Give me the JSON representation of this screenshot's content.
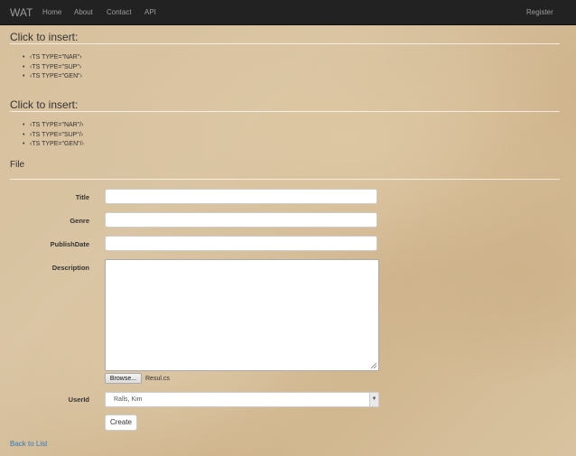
{
  "navbar": {
    "brand": "WAT",
    "links": [
      "Home",
      "About",
      "Contact",
      "API"
    ],
    "register": "Register"
  },
  "insert_sections": [
    {
      "heading": "Click to insert:",
      "items": [
        "‹TS TYPE=\"NAR\"›",
        "‹TS TYPE=\"SUP\"›",
        "‹TS TYPE=\"GEN\"›"
      ]
    },
    {
      "heading": "Click to insert:",
      "items": [
        "‹TS TYPE=\"NAR\"/›",
        "‹TS TYPE=\"SUP\"/›",
        "‹TS TYPE=\"GEN\"/›"
      ]
    }
  ],
  "form": {
    "title": "File",
    "fields": {
      "title": {
        "label": "Title",
        "value": ""
      },
      "genre": {
        "label": "Genre",
        "value": ""
      },
      "publish_date": {
        "label": "PublishDate",
        "value": ""
      },
      "description": {
        "label": "Description",
        "value": ""
      }
    },
    "file_input": {
      "button": "Browse...",
      "filename": "Resul.cs"
    },
    "user": {
      "label": "UserId",
      "selected": "Ralls, Kim"
    },
    "create_button": "Create"
  },
  "back_link": "Back to List"
}
